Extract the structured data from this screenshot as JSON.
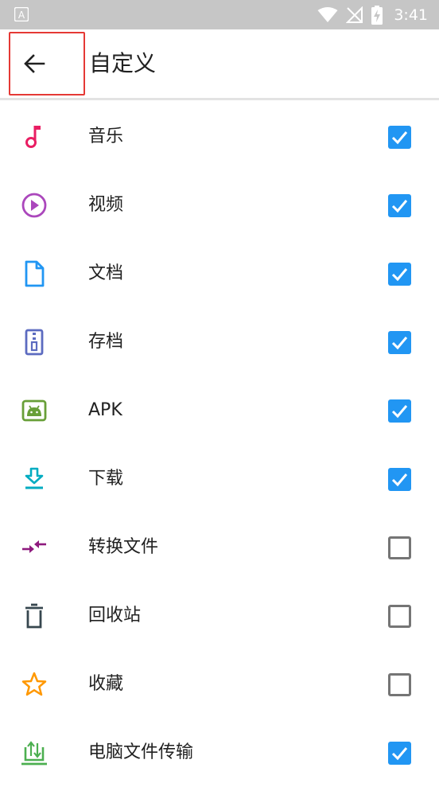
{
  "status_bar": {
    "time": "3:41",
    "icons": [
      "notification-a-icon",
      "wifi-icon",
      "no-signal-icon",
      "battery-charging-icon"
    ]
  },
  "toolbar": {
    "title": "自定义",
    "back_icon": "arrow-left-icon"
  },
  "colors": {
    "accent": "#2196f3",
    "music": "#e91e63",
    "video": "#ab47bc",
    "document": "#2196f3",
    "archive": "#5c6bc0",
    "apk": "#689f38",
    "download": "#00acc1",
    "transfer_files": "#8e1a7e",
    "recycle": "#37474f",
    "favorite": "#ff9800",
    "pc_transfer": "#4caf50"
  },
  "items": [
    {
      "label": "音乐",
      "icon": "music-note-icon",
      "checked": true
    },
    {
      "label": "视频",
      "icon": "play-circle-icon",
      "checked": true
    },
    {
      "label": "文档",
      "icon": "document-icon",
      "checked": true
    },
    {
      "label": "存档",
      "icon": "archive-zip-icon",
      "checked": true
    },
    {
      "label": "APK",
      "icon": "android-icon",
      "checked": true
    },
    {
      "label": "下载",
      "icon": "download-icon",
      "checked": true
    },
    {
      "label": "转换文件",
      "icon": "convert-arrows-icon",
      "checked": false
    },
    {
      "label": "回收站",
      "icon": "trash-icon",
      "checked": false
    },
    {
      "label": "收藏",
      "icon": "star-icon",
      "checked": false
    },
    {
      "label": "电脑文件传输",
      "icon": "pc-upload-icon",
      "checked": true
    }
  ]
}
